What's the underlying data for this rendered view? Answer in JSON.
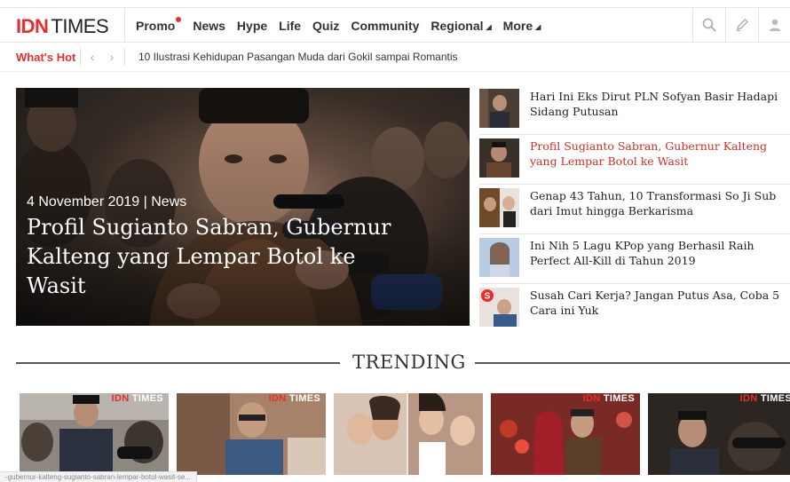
{
  "logo": {
    "idn": "IDN",
    "times": "TIMES"
  },
  "nav": {
    "items": [
      {
        "label": "Promo"
      },
      {
        "label": "News"
      },
      {
        "label": "Hype"
      },
      {
        "label": "Life"
      },
      {
        "label": "Quiz"
      },
      {
        "label": "Community"
      },
      {
        "label": "Regional"
      },
      {
        "label": "More"
      }
    ],
    "icons": [
      "search-icon",
      "pencil-icon",
      "user-icon"
    ]
  },
  "whats_hot": {
    "label": "What's Hot",
    "headline": "10 Ilustrasi Kehidupan Pasangan Muda dari Gokil sampai Romantis"
  },
  "hero": {
    "meta": "4 November 2019 | News",
    "title": "Profil Sugianto Sabran, Gubernur Kalteng yang Lempar Botol ke Wasit"
  },
  "side_list": [
    {
      "title": "Hari Ini Eks Dirut PLN Sofyan Basir Hadapi Sidang Putusan"
    },
    {
      "title": "Profil Sugianto Sabran, Gubernur Kalteng yang Lempar Botol ke Wasit"
    },
    {
      "title": "Genap 43 Tahun, 10 Transformasi So Ji Sub dari Imut hingga Berkarisma"
    },
    {
      "title": "Ini Nih 5 Lagu KPop yang Berhasil Raih Perfect All-Kill di Tahun 2019"
    },
    {
      "title": "Susah Cari Kerja? Jangan Putus Asa, Coba 5 Cara ini Yuk"
    }
  ],
  "trending": {
    "label": "TRENDING",
    "watermark_idn": "IDN",
    "watermark_times": "TIMES"
  },
  "status_url": "-gubernur-kalteng-sugianto-sabran-lempar-botol-wasit-se...",
  "colors": {
    "accent": "#e52f2f",
    "active_link": "#c9302c"
  }
}
